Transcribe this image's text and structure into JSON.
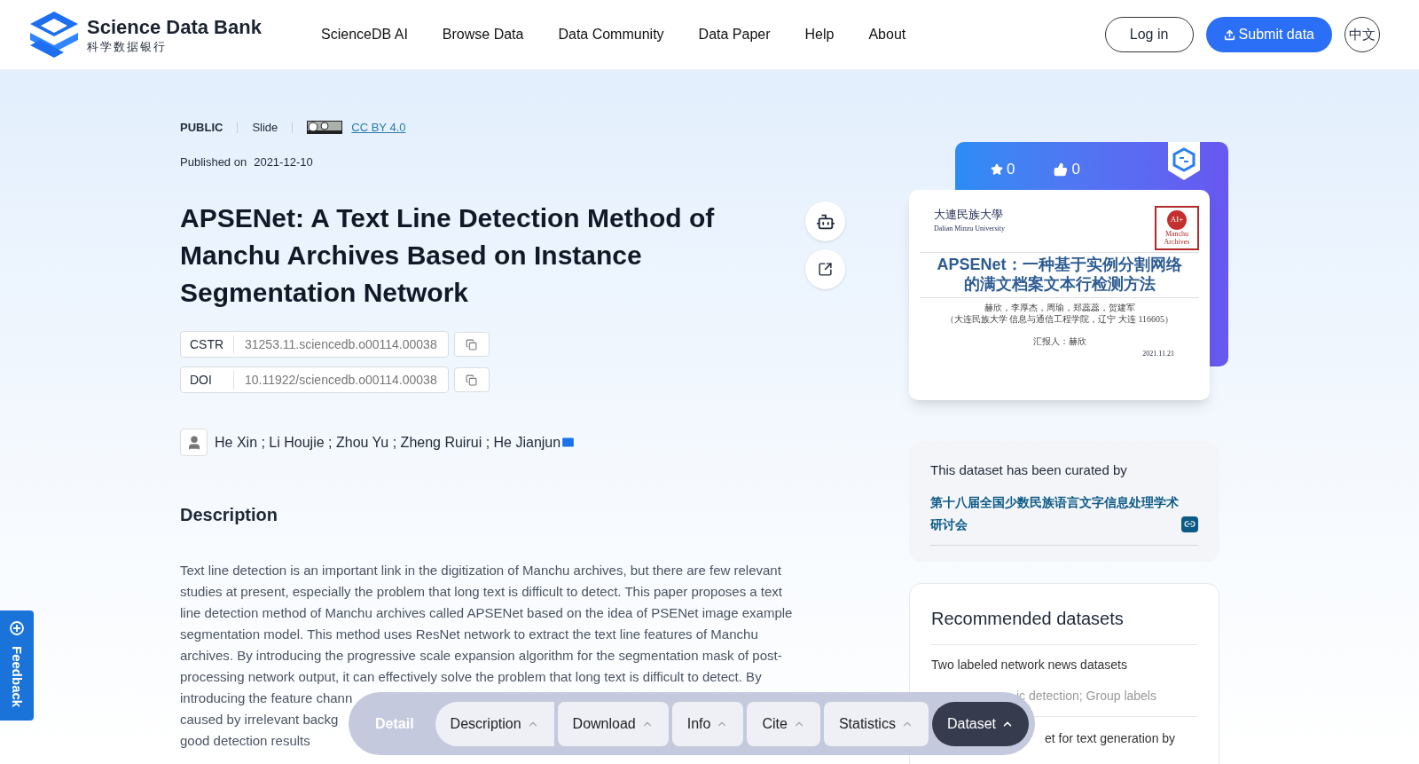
{
  "header": {
    "logo": {
      "title": "Science Data Bank",
      "subtitle": "科学数据银行"
    },
    "nav": [
      "ScienceDB AI",
      "Browse Data",
      "Data Community",
      "Data Paper",
      "Help",
      "About"
    ],
    "login": "Log in",
    "submit": "Submit data",
    "language": "中文"
  },
  "meta": {
    "access": "PUBLIC",
    "type": "Slide",
    "license": "CC BY 4.0",
    "published_label": "Published on",
    "published_date": "2021-12-10"
  },
  "title": "APSENet: A Text Line Detection Method of Manchu Archives Based on Instance Segmentation Network",
  "identifiers": [
    {
      "label": "CSTR",
      "value": "31253.11.sciencedb.o00114.00038"
    },
    {
      "label": "DOI",
      "value": "10.11922/sciencedb.o00114.00038"
    }
  ],
  "authors": "He Xin ; Li Houjie ; Zhou Yu ; Zheng Ruirui ; He Jianjun",
  "description": {
    "heading": "Description",
    "lines": [
      "Text line detection is an important link in the digitization of Manchu archives, but there are few relevant",
      "studies at present, especially the problem that long text is difficult to detect. This paper proposes a text",
      "line detection method of Manchu archives called APSENet based on the idea of PSENet image example",
      "segmentation model. This method uses ResNet network to extract the text line features of Manchu",
      "archives. By introducing the progressive scale expansion algorithm for the segmentation mask of post-",
      "processing network output, it can effectively solve the problem that long text is difficult to detect. By",
      "introducing the feature chann",
      "caused by irrelevant backg",
      "good detection results"
    ]
  },
  "counts": {
    "favorites": "0",
    "likes": "0"
  },
  "slide": {
    "university": "大連民族大學",
    "university_en": "Dalian Minzu University",
    "stamp": "AI+",
    "stamp_text": "Manchu Archives",
    "title_lines": [
      "APSENet：一种基于实例分割网络",
      "的满文档案文本行检测方法"
    ],
    "authors": "赫欣，李厚杰，周瑜，郑蕊蕊，贺建军",
    "affiliation": "（大连民族大学 信息与通信工程学院，辽宁 大连 116605）",
    "reporter": "汇报人：赫欣",
    "date": "2021.11.21"
  },
  "curation": {
    "heading": "This dataset has been curated by",
    "curator": "第十八届全国少数民族语言文字信息处理学术研讨会"
  },
  "recommended": {
    "heading": "Recommended datasets",
    "items": [
      {
        "title": "Two labeled network news datasets",
        "tags": "ic detection; Group labels"
      },
      {
        "title": "et for text generation by"
      }
    ]
  },
  "bottom_bar": {
    "label": "Detail",
    "tabs": [
      {
        "label": "Description",
        "selected": false
      },
      {
        "label": "Download",
        "selected": false
      },
      {
        "label": "Info",
        "selected": false
      },
      {
        "label": "Cite",
        "selected": false
      },
      {
        "label": "Statistics",
        "selected": false
      },
      {
        "label": "Dataset",
        "selected": true
      }
    ]
  },
  "feedback": "Feedback"
}
